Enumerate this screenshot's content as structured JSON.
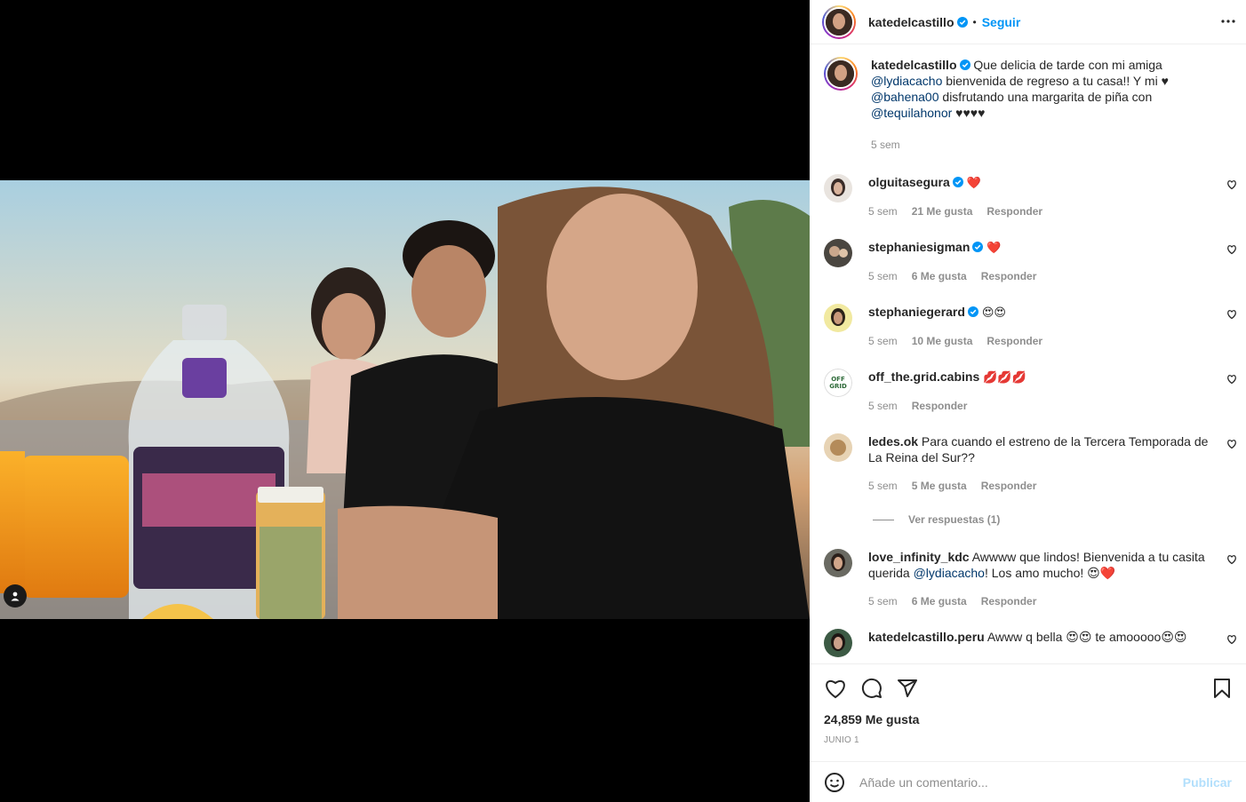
{
  "post": {
    "author": "katedelcastillo",
    "follow_label": "Seguir",
    "dot": "•",
    "caption": {
      "text1": "Que delicia de tarde con mi amiga",
      "mention1": "@lydiacacho",
      "text2": "bienvenida de regreso a tu casa!! Y mi ♥",
      "mention2": "@bahena00",
      "text3": "disfrutando una margarita de piña con",
      "mention3": "@tequilahonor",
      "text4": "♥♥♥♥",
      "time": "5 sem"
    },
    "likes": "24,859 Me gusta",
    "date": "JUNIO 1"
  },
  "comments": [
    {
      "user": "olguitasegura",
      "verified": true,
      "text": "❤️",
      "time": "5 sem",
      "likes": "21 Me gusta",
      "reply": "Responder"
    },
    {
      "user": "stephaniesigman",
      "verified": true,
      "text": "❤️",
      "time": "5 sem",
      "likes": "6 Me gusta",
      "reply": "Responder"
    },
    {
      "user": "stephaniegerard",
      "verified": true,
      "text": "😍😍",
      "time": "5 sem",
      "likes": "10 Me gusta",
      "reply": "Responder"
    },
    {
      "user": "off_the.grid.cabins",
      "verified": false,
      "text": "💋💋💋",
      "time": "5 sem",
      "likes": "",
      "reply": "Responder"
    },
    {
      "user": "ledes.ok",
      "verified": false,
      "text": "Para cuando el estreno de la Tercera Temporada de La Reina del Sur??",
      "time": "5 sem",
      "likes": "5 Me gusta",
      "reply": "Responder",
      "view_replies": "Ver respuestas (1)"
    },
    {
      "user": "love_infinity_kdc",
      "verified": false,
      "text1": "Awwww que lindos! Bienvenida a tu casita querida",
      "mention": "@lydiacacho",
      "text2": "! Los amo mucho! 😍❤️",
      "time": "5 sem",
      "likes": "6 Me gusta",
      "reply": "Responder"
    },
    {
      "user": "katedelcastillo.peru",
      "verified": false,
      "text": "Awww q bella 😍😍 te amooooo😍😍"
    }
  ],
  "add_comment": {
    "placeholder": "Añade un comentario...",
    "publish": "Publicar"
  },
  "icons": [
    "more-icon",
    "heart-icon",
    "comment-icon",
    "share-icon",
    "bookmark-icon",
    "emoji-icon",
    "user-tag-icon",
    "verified-badge-icon"
  ],
  "colors": {
    "accent": "#0095f6",
    "mention": "#00376b",
    "secondary": "#8e8e8e",
    "publish_disabled": "#b2dffc"
  }
}
